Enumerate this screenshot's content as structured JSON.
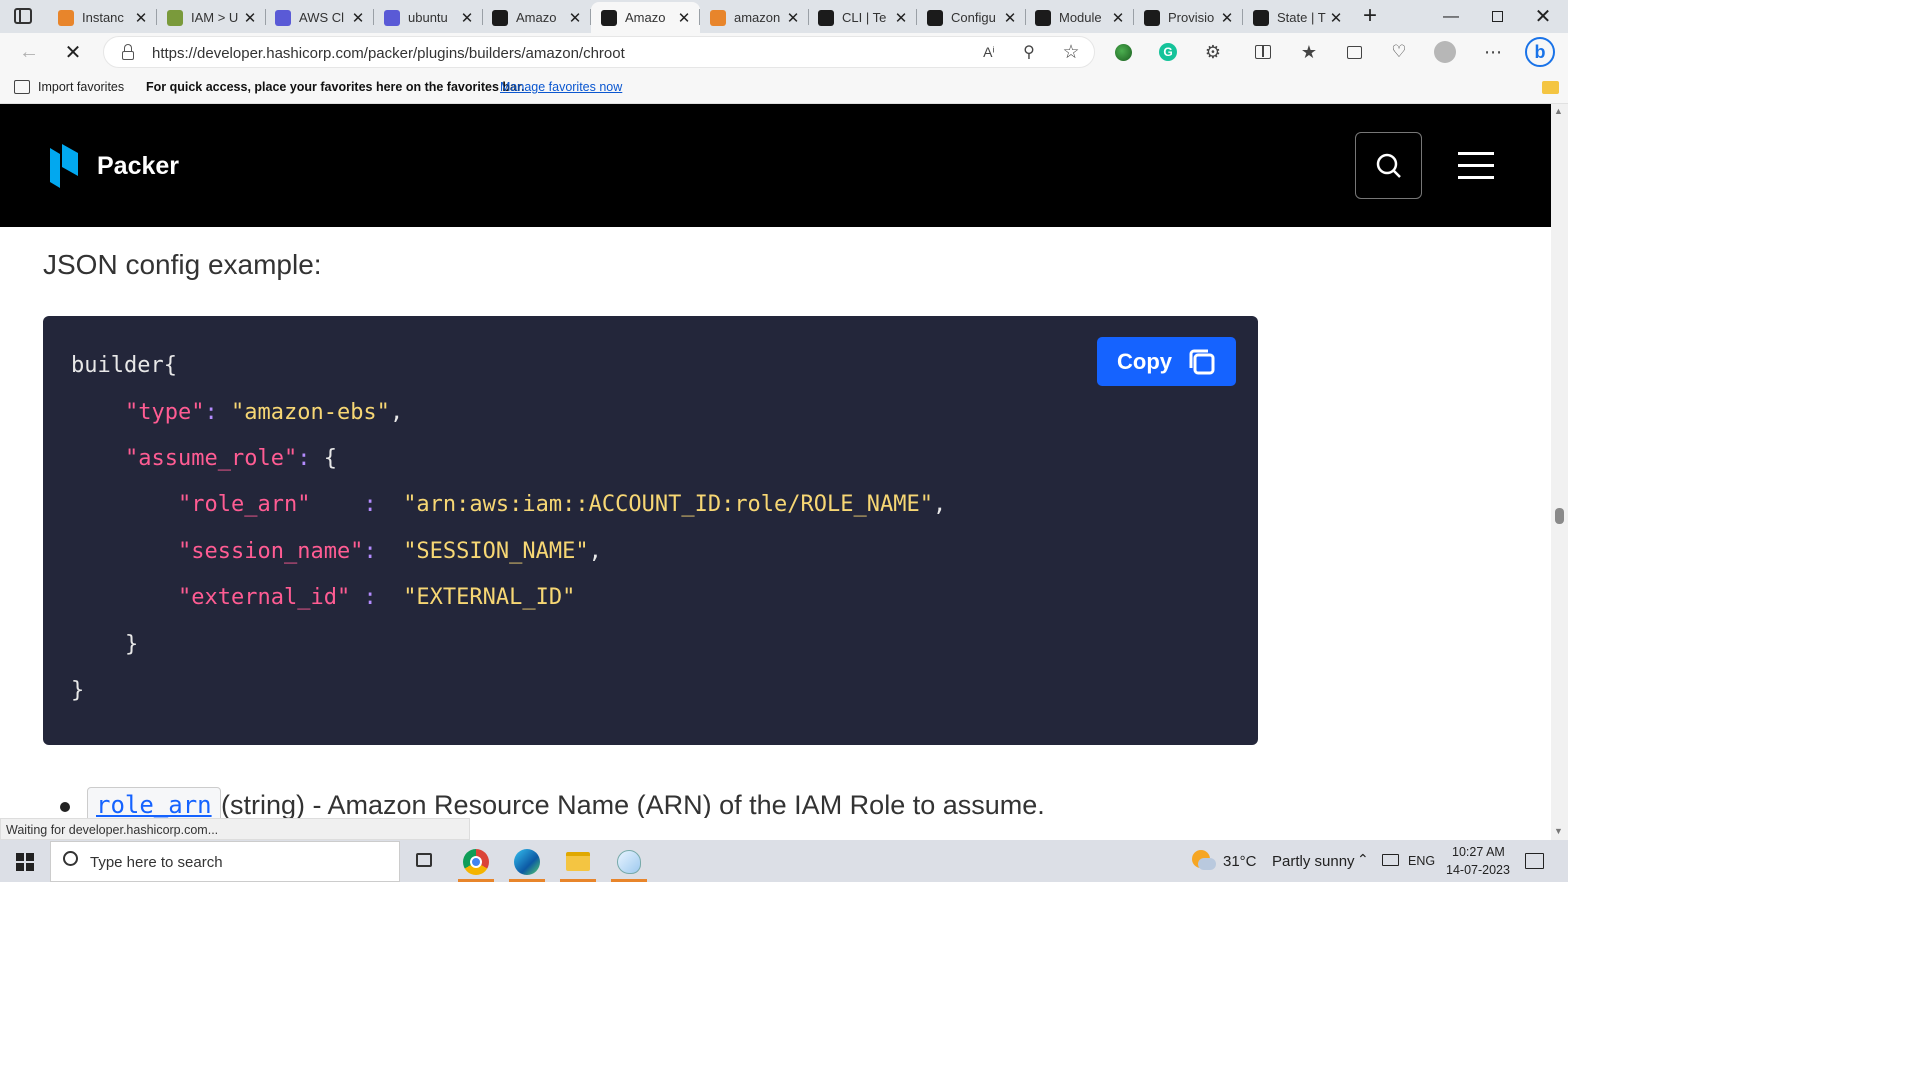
{
  "tabs": [
    {
      "label": "Instanc",
      "icon": "aws-icon",
      "color": "#e8852b"
    },
    {
      "label": "IAM > U",
      "icon": "iam-icon",
      "color": "#7a9a3b"
    },
    {
      "label": "AWS Cl",
      "icon": "cloud-icon",
      "color": "#5a5ad6"
    },
    {
      "label": "ubuntu",
      "icon": "cloud-icon",
      "color": "#5a5ad6"
    },
    {
      "label": "Amazo",
      "icon": "hashicorp-icon",
      "color": "#1b1b1b"
    },
    {
      "label": "Amazo",
      "icon": "hashicorp-icon",
      "color": "#1b1b1b",
      "active": true
    },
    {
      "label": "amazon",
      "icon": "stackoverflow-icon",
      "color": "#e8852b"
    },
    {
      "label": "CLI | Te",
      "icon": "hashicorp-icon",
      "color": "#1b1b1b"
    },
    {
      "label": "Configu",
      "icon": "hashicorp-icon",
      "color": "#1b1b1b"
    },
    {
      "label": "Module",
      "icon": "hashicorp-icon",
      "color": "#1b1b1b"
    },
    {
      "label": "Provisio",
      "icon": "hashicorp-icon",
      "color": "#1b1b1b"
    },
    {
      "label": "State | T",
      "icon": "hashicorp-icon",
      "color": "#1b1b1b"
    }
  ],
  "address": {
    "url": "https://developer.hashicorp.com/packer/plugins/builders/amazon/chroot"
  },
  "favorites": {
    "import_label": "Import favorites",
    "message": "For quick access, place your favorites here on the favorites bar.",
    "manage_link": "Manage favorites now"
  },
  "site": {
    "brand": "Packer",
    "heading": "JSON config example:",
    "copy_label": "Copy",
    "bullet_code": "role_arn",
    "bullet_text": "(string) - Amazon Resource Name (ARN) of the IAM Role to assume."
  },
  "code": {
    "l1_a": "builder",
    "l1_b": "{",
    "l2_k": "\"type\"",
    "l2_c": ":",
    "l2_v": "\"amazon-ebs\"",
    "l2_e": ",",
    "l3_k": "\"assume_role\"",
    "l3_c": ":",
    "l3_b": "{",
    "l4_k": "\"role_arn\"",
    "l4_c": ":",
    "l4_v": "\"arn:aws:iam::ACCOUNT_ID:role/ROLE_NAME\"",
    "l4_e": ",",
    "l5_k": "\"session_name\"",
    "l5_c": ":",
    "l5_v": "\"SESSION_NAME\"",
    "l5_e": ",",
    "l6_k": "\"external_id\"",
    "l6_c": ":",
    "l6_v": "\"EXTERNAL_ID\"",
    "l7": "}",
    "l8": "}"
  },
  "status": "Waiting for developer.hashicorp.com...",
  "taskbar": {
    "search_placeholder": "Type here to search",
    "weather_temp": "31°C",
    "weather_desc": "Partly sunny",
    "lang": "ENG",
    "time": "10:27 AM",
    "date": "14-07-2023"
  }
}
